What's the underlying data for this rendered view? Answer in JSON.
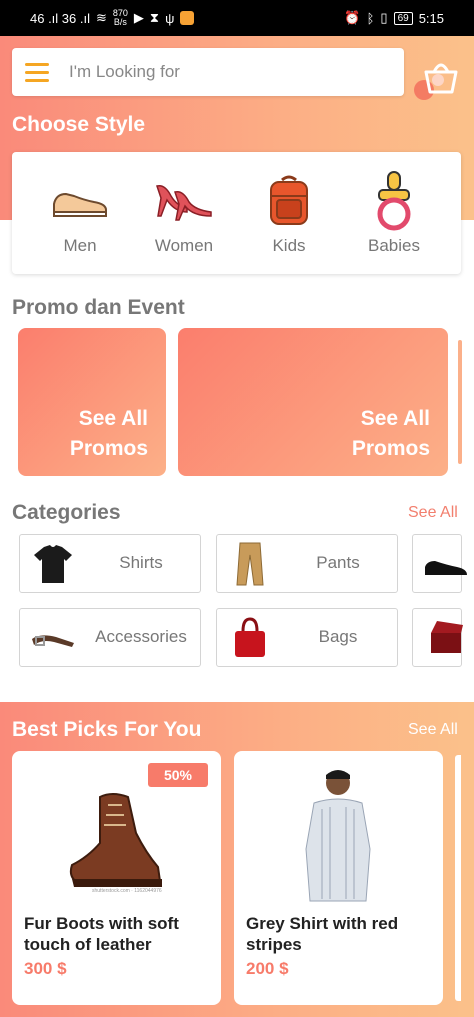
{
  "status_bar": {
    "left_signal": "46 .ıl 36 .ıl",
    "net_speed_value": "870",
    "net_speed_unit": "B/s",
    "time": "5:15",
    "battery": "69"
  },
  "search": {
    "placeholder": "I'm Looking for"
  },
  "choose_style": {
    "title": "Choose Style",
    "items": [
      {
        "label": "Men",
        "icon": "sneaker-icon"
      },
      {
        "label": "Women",
        "icon": "high-heels-icon"
      },
      {
        "label": "Kids",
        "icon": "backpack-icon"
      },
      {
        "label": "Babies",
        "icon": "pacifier-icon"
      }
    ]
  },
  "promo": {
    "title": "Promo dan Event",
    "cards": [
      {
        "line1": "See All",
        "line2": "Promos"
      },
      {
        "line1": "See All",
        "line2": "Promos"
      }
    ]
  },
  "categories": {
    "title": "Categories",
    "see_all": "See All",
    "items": [
      {
        "label": "Shirts",
        "icon": "tshirt-icon"
      },
      {
        "label": "Pants",
        "icon": "pants-icon"
      },
      {
        "label": "",
        "icon": "shoe-icon"
      },
      {
        "label": "Accessories",
        "icon": "belt-icon"
      },
      {
        "label": "Bags",
        "icon": "handbag-icon"
      },
      {
        "label": "",
        "icon": "jewelry-box-icon"
      }
    ]
  },
  "best_picks": {
    "title": "Best Picks For You",
    "see_all": "See All",
    "products": [
      {
        "name": "Fur Boots with soft touch of leather",
        "price": "300 $",
        "badge": "50%",
        "image_caption": "shutterstock.com · 1162044976"
      },
      {
        "name": "Grey Shirt with red stripes",
        "price": "200 $"
      }
    ]
  },
  "colors": {
    "accent": "#f77b6a",
    "gradient_start": "#fa8a7a",
    "gradient_end": "#fbc18a",
    "menu_icon": "#f5a623"
  }
}
